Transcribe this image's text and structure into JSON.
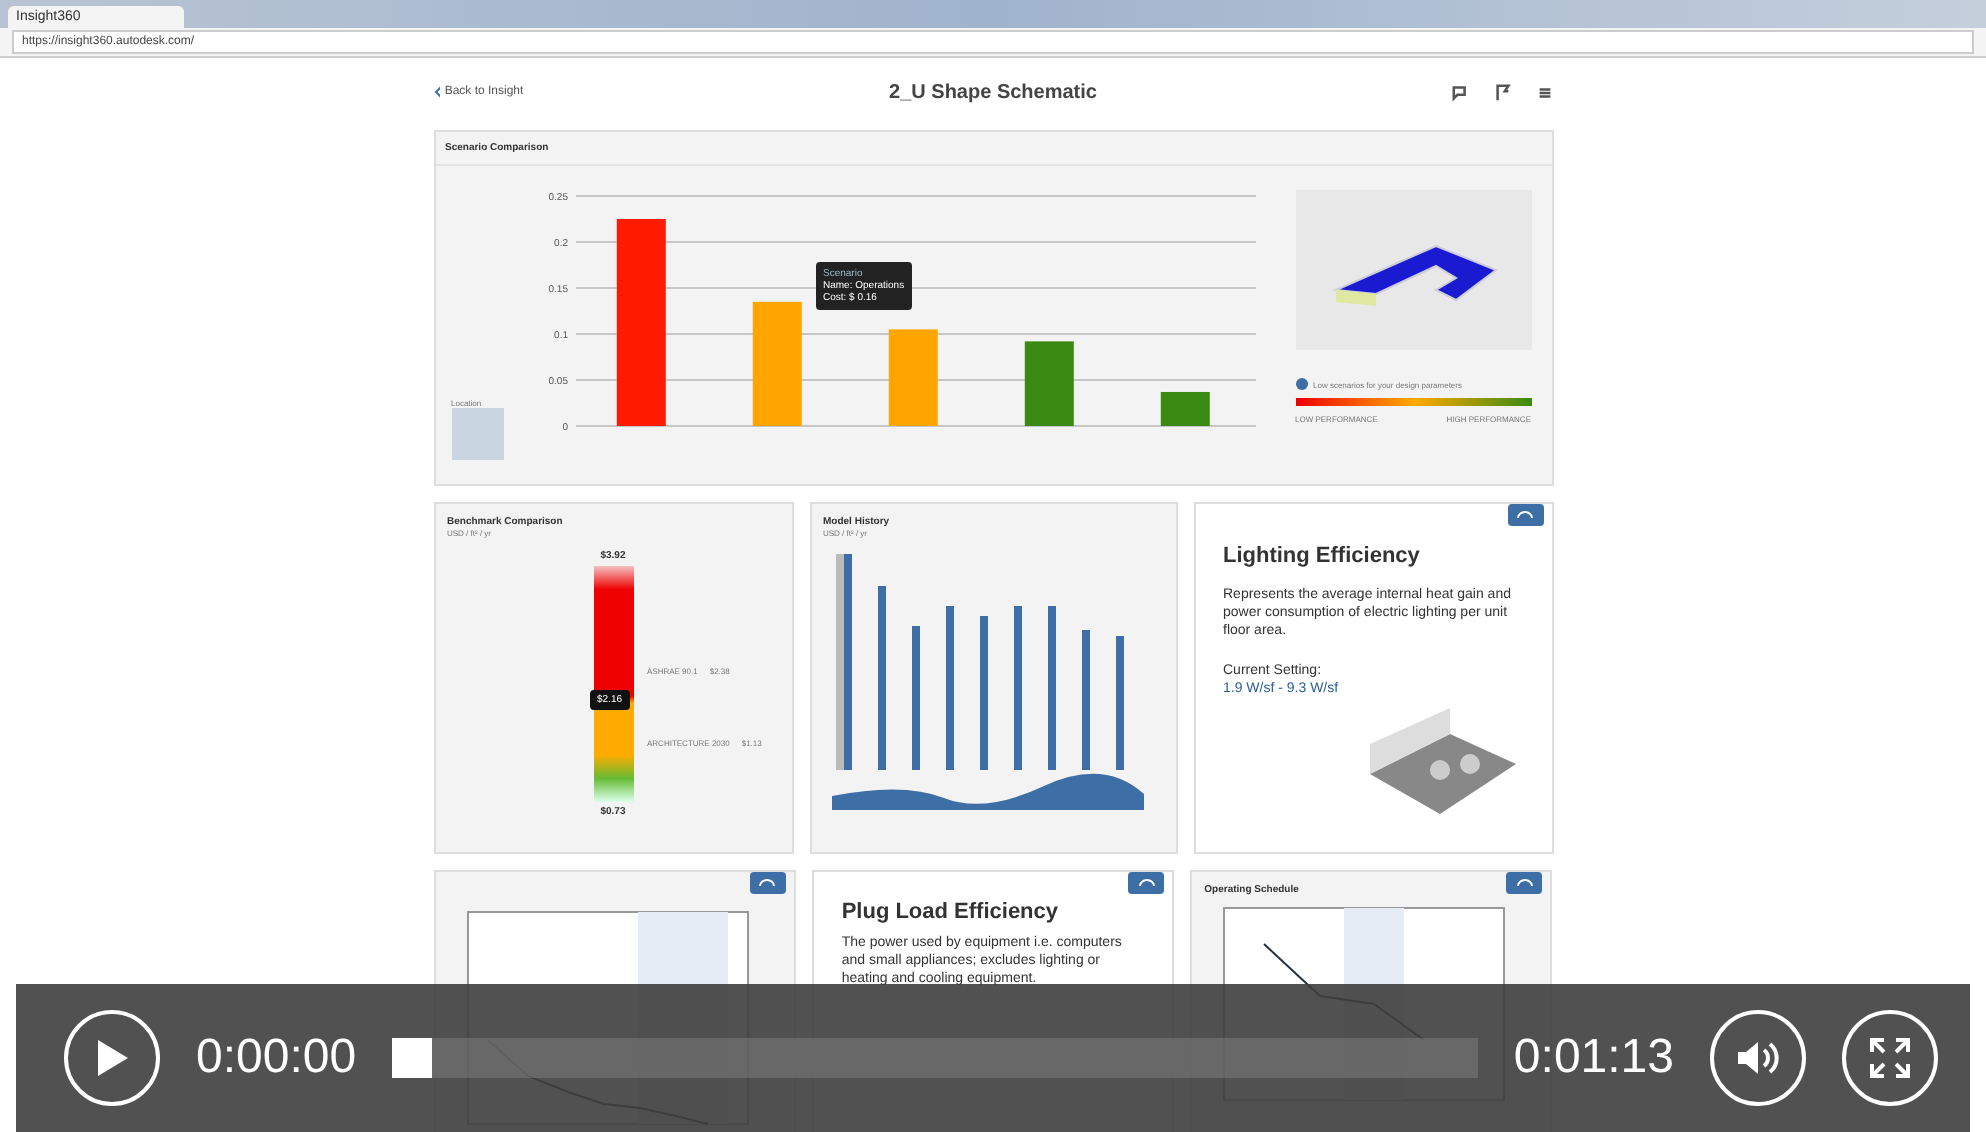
{
  "browser": {
    "tab_title": "Insight360",
    "url": "https://insight360.autodesk.com/"
  },
  "header": {
    "back": "Back to Insight",
    "title": "2_U Shape Schematic"
  },
  "scenario": {
    "title": "Scenario Comparison",
    "location": "Location",
    "tooltip": {
      "heading": "Scenario",
      "name": "Name: Operations",
      "cost": "Cost: $ 0.16"
    },
    "chart_data": {
      "type": "bar",
      "values": [
        0.225,
        0.135,
        0.105,
        0.092,
        0.037
      ],
      "ylim": [
        0,
        0.25
      ],
      "yticks": [
        0,
        0.05,
        0.1,
        0.15,
        0.2,
        0.25
      ],
      "grid": true
    },
    "bars": [
      {
        "color": "#ff1a00"
      },
      {
        "color": "#ffa500"
      },
      {
        "color": "#ffa500"
      },
      {
        "color": "#3a8a12"
      },
      {
        "color": "#3a8a12"
      }
    ],
    "info": "Low scenarios for your design parameters",
    "low": "LOW PERFORMANCE",
    "high": "HIGH PERFORMANCE"
  },
  "benchmark": {
    "title": "Benchmark Comparison",
    "unit": "USD / ft² / yr",
    "top": "$3.92",
    "bottom": "$0.73",
    "marker": "$2.16",
    "refs": [
      {
        "label": "ASHRAE 90.1",
        "value": "$2.38"
      },
      {
        "label": "ARCHITECTURE 2030",
        "value": "$1.13"
      }
    ]
  },
  "history": {
    "title": "Model History",
    "unit": "USD / ft² / yr"
  },
  "lighting": {
    "title": "Lighting Efficiency",
    "text": "Represents the average internal heat gain and power consumption of electric lighting per unit floor area.",
    "setting_label": "Current Setting:",
    "setting": "1.9 W/sf - 9.3 W/sf"
  },
  "plug": {
    "title": "Plug Load Efficiency",
    "text": "The power used by equipment i.e. computers and small appliances; excludes lighting or heating and cooling equipment."
  },
  "schedule": {
    "title": "Operating Schedule"
  },
  "player": {
    "elapsed": "0:00:00",
    "total": "0:01:13",
    "level": 0
  }
}
